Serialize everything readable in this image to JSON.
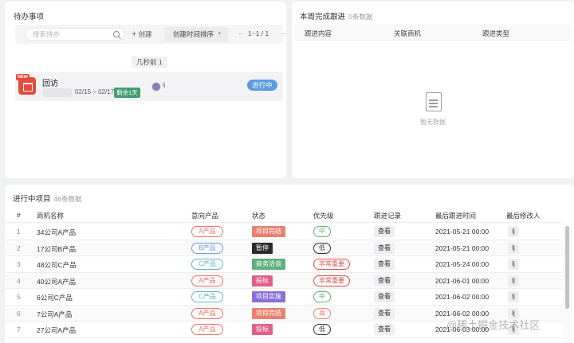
{
  "todo": {
    "title": "待办事项",
    "search_placeholder": "搜索待办",
    "create_label": "创建",
    "sort_label": "创建时间排序",
    "pagination": "1~1 / 1",
    "time_tag": "几秒前 1",
    "item": {
      "badge": "NEW",
      "title": "回访",
      "date_range": "02/15 ~ 02/17",
      "remain": "剩余1天",
      "member": "lj",
      "status": "进行中"
    }
  },
  "week": {
    "title": "本周完成跟进",
    "count": "0条数据",
    "columns": [
      "跟进内容",
      "关联商机",
      "跟进类型"
    ],
    "empty_text": "暂无数据"
  },
  "projects": {
    "title": "进行中项目",
    "count": "46条数据",
    "columns": [
      "#",
      "商机名称",
      "意向产品",
      "状态",
      "优先级",
      "跟进记录",
      "最后跟进时间",
      "最后修改人"
    ],
    "rows": [
      {
        "idx": "1",
        "name": "34公司A产品",
        "product": "A产品",
        "status": "项目完结",
        "priority": "中",
        "record": "查看",
        "time": "2021-05-21 00:00",
        "editor": "lj"
      },
      {
        "idx": "2",
        "name": "17公司B产品",
        "product": "B产品",
        "status": "暂停",
        "priority": "低",
        "record": "查看",
        "time": "2021-05-21 00:00",
        "editor": "lj"
      },
      {
        "idx": "3",
        "name": "48公司C产品",
        "product": "C产品",
        "status": "商务洽谈",
        "priority": "非常重要",
        "record": "查看",
        "time": "2021-05-24 00:00",
        "editor": "lj"
      },
      {
        "idx": "4",
        "name": "40公司A产品",
        "product": "A产品",
        "status": "投标",
        "priority": "非常重要",
        "record": "查看",
        "time": "2021-06-01 00:00",
        "editor": "lj"
      },
      {
        "idx": "5",
        "name": "6公司C产品",
        "product": "C产品",
        "status": "项目实施",
        "priority": "中",
        "record": "查看",
        "time": "2021-06-02 00:00",
        "editor": "lj"
      },
      {
        "idx": "6",
        "name": "7公司A产品",
        "product": "A产品",
        "status": "项目完结",
        "priority": "高",
        "record": "查看",
        "time": "2021-06-02 00:00",
        "editor": "lj"
      },
      {
        "idx": "7",
        "name": "27公司A产品",
        "product": "A产品",
        "status": "投标",
        "priority": "低",
        "record": "查看",
        "time": "2021-06-03 00:00",
        "editor": "lj"
      }
    ]
  },
  "colors": {
    "product": {
      "A产品": "#e8736b",
      "B产品": "#6a9de0",
      "C产品": "#5bb6c9"
    },
    "status": {
      "项目完结": "#e8826f",
      "暂停": "#2b2b2b",
      "商务洽谈": "#5fb07a",
      "投标": "#e0608a",
      "项目实施": "#8a6fd6"
    },
    "priority": {
      "中": "#5fb07a",
      "低": "#333333",
      "非常重要": "#d9534f",
      "高": "#e8826f"
    }
  },
  "watermark": "@稀土掘金技术社区"
}
